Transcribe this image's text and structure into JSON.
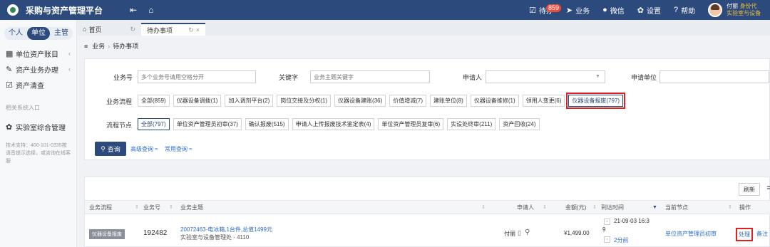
{
  "app": {
    "title": "采购与资产管理平台",
    "icons": [
      "logo-icon",
      "collapse-icon",
      "home-icon"
    ]
  },
  "topbar": {
    "todo_label": "待办",
    "todo_count": "859",
    "business_label": "业务",
    "wechat_label": "微信",
    "settings_label": "设置",
    "help_label": "帮助",
    "user_name": "付丽",
    "user_role": "身份代",
    "user_org": "实验室与设备"
  },
  "sidebar": {
    "role_tabs": [
      "个人",
      "单位",
      "主管"
    ],
    "active_role": "单位",
    "items": [
      {
        "label": "单位资产账目",
        "icon": "grid-icon"
      },
      {
        "label": "资产业务办理",
        "icon": "edit-icon"
      },
      {
        "label": "资产清查",
        "icon": "check-icon"
      }
    ],
    "section_title": "相关系统入口",
    "lab_system": "实验室综合管理",
    "support_note": "技术支持：400-101-0335按语音提示选择，或咨询在线客服"
  },
  "tabs": {
    "home": "首页",
    "active": "待办事项"
  },
  "breadcrumb": {
    "root": "业务",
    "sep": "›",
    "current": "待办事项"
  },
  "filters": {
    "business_no_label": "业务号",
    "business_no_placeholder": "多个业务号请用空格分开",
    "keyword_label": "关键字",
    "keyword_placeholder": "业务主题关键字",
    "applicant_label": "申请人",
    "apply_unit_label": "申请单位",
    "flow_label": "业务流程",
    "flows": [
      "全部(859)",
      "仪器设备调拨(1)",
      "加入调剂平台(2)",
      "岗位交接及分权(1)",
      "仪器设备建账(36)",
      "价值增减(7)",
      "建账单位(8)",
      "仪器设备维修(1)",
      "领用人变更(6)",
      "仪器设备报废(797)"
    ],
    "node_label": "流程节点",
    "nodes": [
      "全部(797)",
      "单位资产管理员初审(37)",
      "确认报废(515)",
      "申请人上传报废技术鉴定表(4)",
      "单位资产管理员复审(6)",
      "实设处终审(211)",
      "资产回收(24)"
    ],
    "query_button": "查询",
    "advanced_query": "高级查询 ≈",
    "common_query": "常用查询 ≈"
  },
  "table": {
    "refresh_button": "刷新",
    "extra_button": "≣",
    "columns": [
      "业务流程",
      "业务号",
      "业务主题",
      "申请人",
      "金额(元)",
      "到达时间",
      "当前节点",
      "操作"
    ],
    "rows": [
      {
        "flow": "仪器设备报废",
        "business_no": "192482",
        "subject_title": "20072463-电冰箱,1台件,总值1499元",
        "subject_detail": "实验室与设备管理处 - 4110",
        "applicant": "付丽",
        "amount": "¥1,499.00",
        "arrive_time_line1": "21-09-03 16:3",
        "arrive_time_line2": "9",
        "arrive_elapsed": "2分前",
        "current_node": "单位资产管理员初审",
        "op_process": "处理",
        "op_remark": "备注"
      }
    ]
  },
  "colors": {
    "primary": "#2c4a7c",
    "highlight": "#e02020",
    "link": "#2c6ecb"
  }
}
